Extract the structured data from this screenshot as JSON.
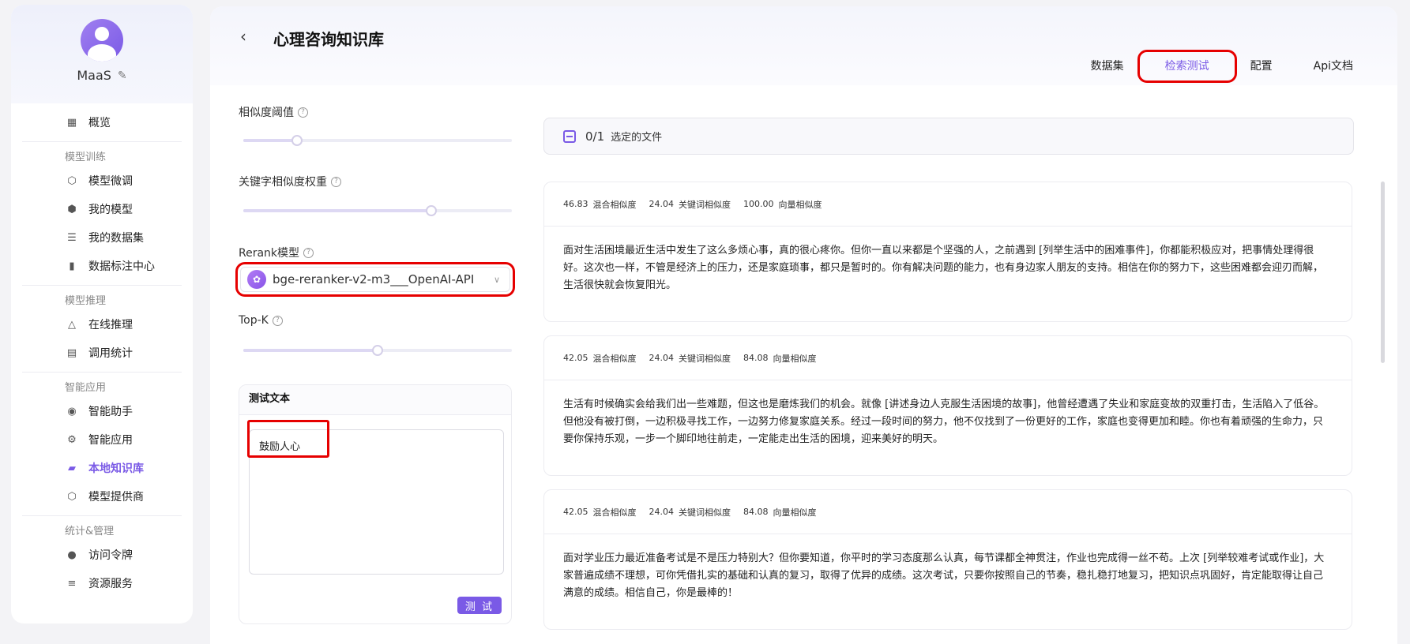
{
  "sidebar": {
    "username": "MaaS",
    "items": [
      {
        "label": "概览",
        "icon": "grid-icon"
      },
      {
        "group": "模型训练"
      },
      {
        "label": "模型微调",
        "icon": "cube-icon"
      },
      {
        "label": "我的模型",
        "icon": "model-icon"
      },
      {
        "label": "我的数据集",
        "icon": "dataset-icon"
      },
      {
        "label": "数据标注中心",
        "icon": "bookmark-icon"
      },
      {
        "group": "模型推理"
      },
      {
        "label": "在线推理",
        "icon": "triangle-icon"
      },
      {
        "label": "调用统计",
        "icon": "chart-icon"
      },
      {
        "group": "智能应用"
      },
      {
        "label": "智能助手",
        "icon": "robot-icon"
      },
      {
        "label": "智能应用",
        "icon": "gear-icon"
      },
      {
        "label": "本地知识库",
        "icon": "folder-icon",
        "active": true
      },
      {
        "label": "模型提供商",
        "icon": "cube-icon"
      },
      {
        "group": "统计&管理"
      },
      {
        "label": "访问令牌",
        "icon": "token-icon"
      },
      {
        "label": "资源服务",
        "icon": "database-icon"
      }
    ]
  },
  "header": {
    "title": "心理咨询知识库",
    "tabs": [
      "数据集",
      "检索测试",
      "配置",
      "Api文档"
    ],
    "active_tab": "检索测试"
  },
  "controls": {
    "similarity_label": "相似度阈值",
    "similarity_value": 0.2,
    "keyword_label": "关键字相似度权重",
    "keyword_value": 0.7,
    "rerank_label": "Rerank模型",
    "rerank_value": "bge-reranker-v2-m3___OpenAI-API",
    "topk_label": "Top-K",
    "topk_value": 0.5,
    "test_title": "测试文本",
    "test_text": "鼓励人心",
    "test_button": "测 试"
  },
  "files": {
    "count": "0/1",
    "label": "选定的文件"
  },
  "results": [
    {
      "hybrid": "46.83",
      "hybrid_label": "混合相似度",
      "keyword": "24.04",
      "keyword_label": "关键词相似度",
      "vector": "100.00",
      "vector_label": "向量相似度",
      "text": "面对生活困境最近生活中发生了这么多烦心事，真的很心疼你。但你一直以来都是个坚强的人，之前遇到 [列举生活中的困难事件]，你都能积极应对，把事情处理得很好。这次也一样，不管是经济上的压力，还是家庭琐事，都只是暂时的。你有解决问题的能力，也有身边家人朋友的支持。相信在你的努力下，这些困难都会迎刃而解，生活很快就会恢复阳光。"
    },
    {
      "hybrid": "42.05",
      "hybrid_label": "混合相似度",
      "keyword": "24.04",
      "keyword_label": "关键词相似度",
      "vector": "84.08",
      "vector_label": "向量相似度",
      "text": "生活有时候确实会给我们出一些难题，但这也是磨炼我们的机会。就像 [讲述身边人克服生活困境的故事]，他曾经遭遇了失业和家庭变故的双重打击，生活陷入了低谷。但他没有被打倒，一边积极寻找工作，一边努力修复家庭关系。经过一段时间的努力，他不仅找到了一份更好的工作，家庭也变得更加和睦。你也有着顽强的生命力，只要你保持乐观，一步一个脚印地往前走，一定能走出生活的困境，迎来美好的明天。"
    },
    {
      "hybrid": "42.05",
      "hybrid_label": "混合相似度",
      "keyword": "24.04",
      "keyword_label": "关键词相似度",
      "vector": "84.08",
      "vector_label": "向量相似度",
      "text": "面对学业压力最近准备考试是不是压力特别大？但你要知道，你平时的学习态度那么认真，每节课都全神贯注，作业也完成得一丝不苟。上次 [列举较难考试或作业]，大家普遍成绩不理想，可你凭借扎实的基础和认真的复习，取得了优异的成绩。这次考试，只要你按照自己的节奏，稳扎稳打地复习，把知识点巩固好，肯定能取得让自己满意的成绩。相信自己，你是最棒的！"
    }
  ]
}
